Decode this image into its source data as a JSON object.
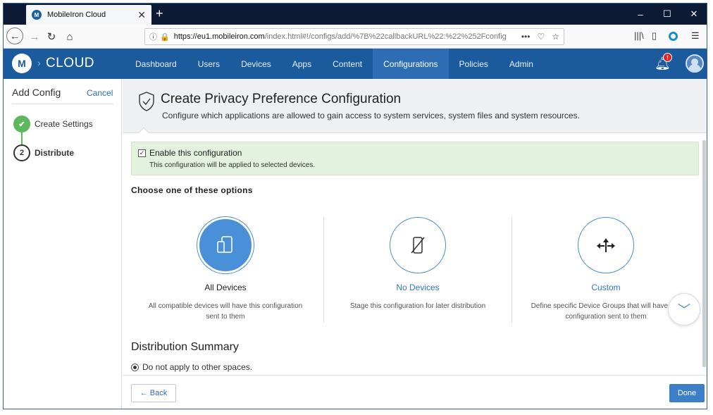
{
  "browser": {
    "tab_title": "MobileIron Cloud",
    "tab_favicon": "M",
    "new_tab_symbol": "+",
    "url_host": "https://eu1.mobileiron.com",
    "url_path": "/index.html#!/configs/add/%7B%22callbackURL%22:%22%252Fconfig",
    "window_controls": [
      "–",
      "☐",
      "✕"
    ]
  },
  "app": {
    "logo_letter": "M",
    "brand": "CLOUD",
    "nav": [
      "Dashboard",
      "Users",
      "Devices",
      "Apps",
      "Content",
      "Configurations",
      "Policies",
      "Admin"
    ],
    "active_nav": "Configurations",
    "notification_badge": "!",
    "colors": {
      "header": "#1c5a9e",
      "accent": "#4a90d9",
      "success": "#5cb85c",
      "link": "#2e78c8"
    }
  },
  "sidebar": {
    "title": "Add Config",
    "cancel": "Cancel",
    "steps": [
      {
        "number": "✔",
        "label": "Create Settings",
        "state": "done"
      },
      {
        "number": "2",
        "label": "Distribute",
        "state": "current"
      }
    ]
  },
  "page": {
    "title": "Create Privacy Preference Configuration",
    "subtitle": "Configure which applications are allowed to gain access to system services, system files and system resources."
  },
  "enable": {
    "checked": true,
    "label": "Enable this configuration",
    "description": "This configuration will be applied to selected devices."
  },
  "choose_label": "Choose one of these options",
  "options": [
    {
      "title": "All Devices",
      "description": "All compatible devices will have this configuration sent to them",
      "icon": "devices-icon",
      "selected": true
    },
    {
      "title": "No Devices",
      "description": "Stage this configuration for later distribution",
      "icon": "no-device-icon",
      "selected": false
    },
    {
      "title": "Custom",
      "description": "Define specific Device Groups that will have this configuration sent to them",
      "icon": "split-arrows-icon",
      "selected": false
    }
  ],
  "distribution_summary": {
    "title": "Distribution Summary",
    "radio_label": "Do not apply to other spaces.",
    "radio_selected": true
  },
  "footer": {
    "back": "← Back",
    "done": "Done"
  }
}
